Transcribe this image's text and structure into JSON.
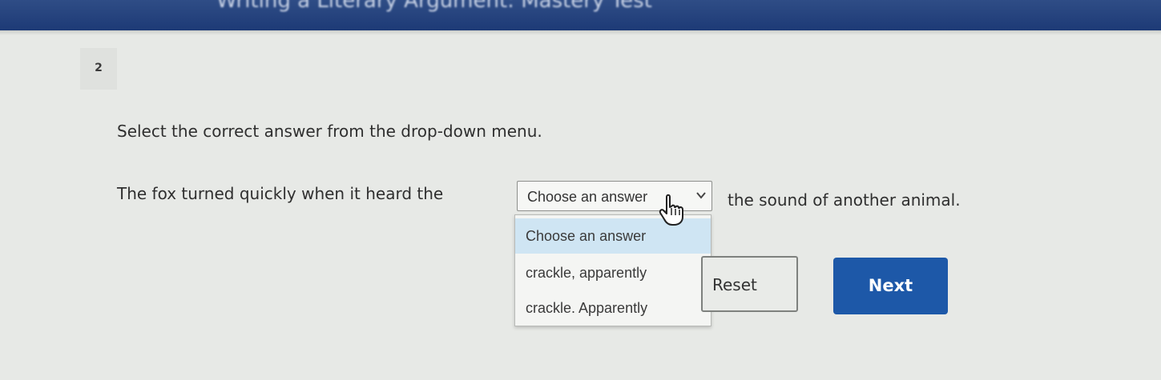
{
  "header": {
    "title": "Writing a Literary Argument: Mastery Test"
  },
  "question": {
    "number": "2",
    "instructions": "Select the correct answer from the drop-down menu.",
    "sentence_before": "The fox turned quickly when it heard the",
    "sentence_after": "the sound of another animal."
  },
  "dropdown": {
    "selected": "Choose an answer",
    "options": [
      "Choose an answer",
      "crackle, apparently",
      "crackle. Apparently"
    ]
  },
  "buttons": {
    "reset": "Reset",
    "next": "Next"
  },
  "colors": {
    "header_bg": "#1d3a76",
    "next_bg": "#1d58a8",
    "option_highlight": "#cfe5f3"
  }
}
